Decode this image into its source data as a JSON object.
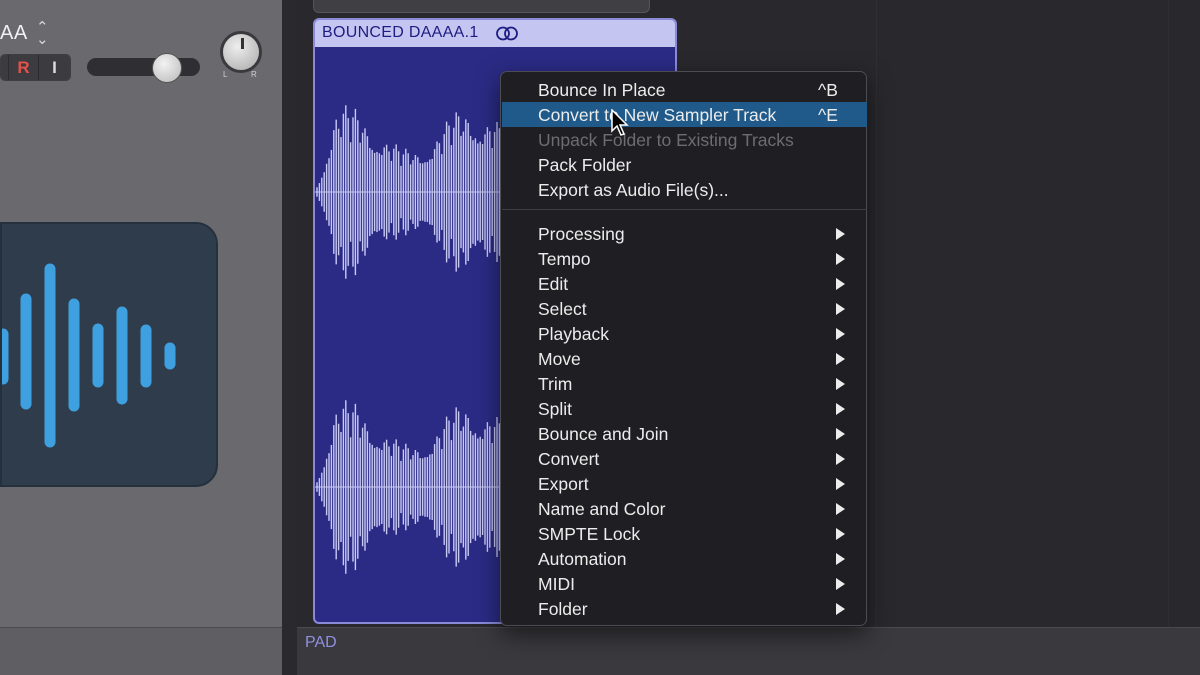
{
  "track_header": {
    "name": "AA",
    "record_button": "R",
    "input_button": "I",
    "pan_left": "L",
    "pan_right": "R"
  },
  "arrange": {
    "bottom_track_label": "PAD"
  },
  "region": {
    "title": "BOUNCED DAAAA.1",
    "loop_icon": "loop-rings-icon",
    "color": "#2b2b86"
  },
  "context_menu": {
    "top_items": [
      {
        "label": "Bounce In Place",
        "shortcut": "^B"
      },
      {
        "label": "Convert to New Sampler Track",
        "shortcut": "^E"
      },
      {
        "label": "Unpack Folder to Existing Tracks"
      },
      {
        "label": "Pack Folder"
      },
      {
        "label": "Export as Audio File(s)..."
      }
    ],
    "submenu_items": [
      "Processing",
      "Tempo",
      "Edit",
      "Select",
      "Playback",
      "Move",
      "Trim",
      "Split",
      "Bounce and Join",
      "Convert",
      "Export",
      "Name and Color",
      "SMPTE Lock",
      "Automation",
      "MIDI",
      "Folder"
    ],
    "highlighted_item": "Convert to New Sampler Track",
    "disabled_item": "Unpack Folder to Existing Tracks",
    "highlight_color": "#1f5a8a"
  }
}
